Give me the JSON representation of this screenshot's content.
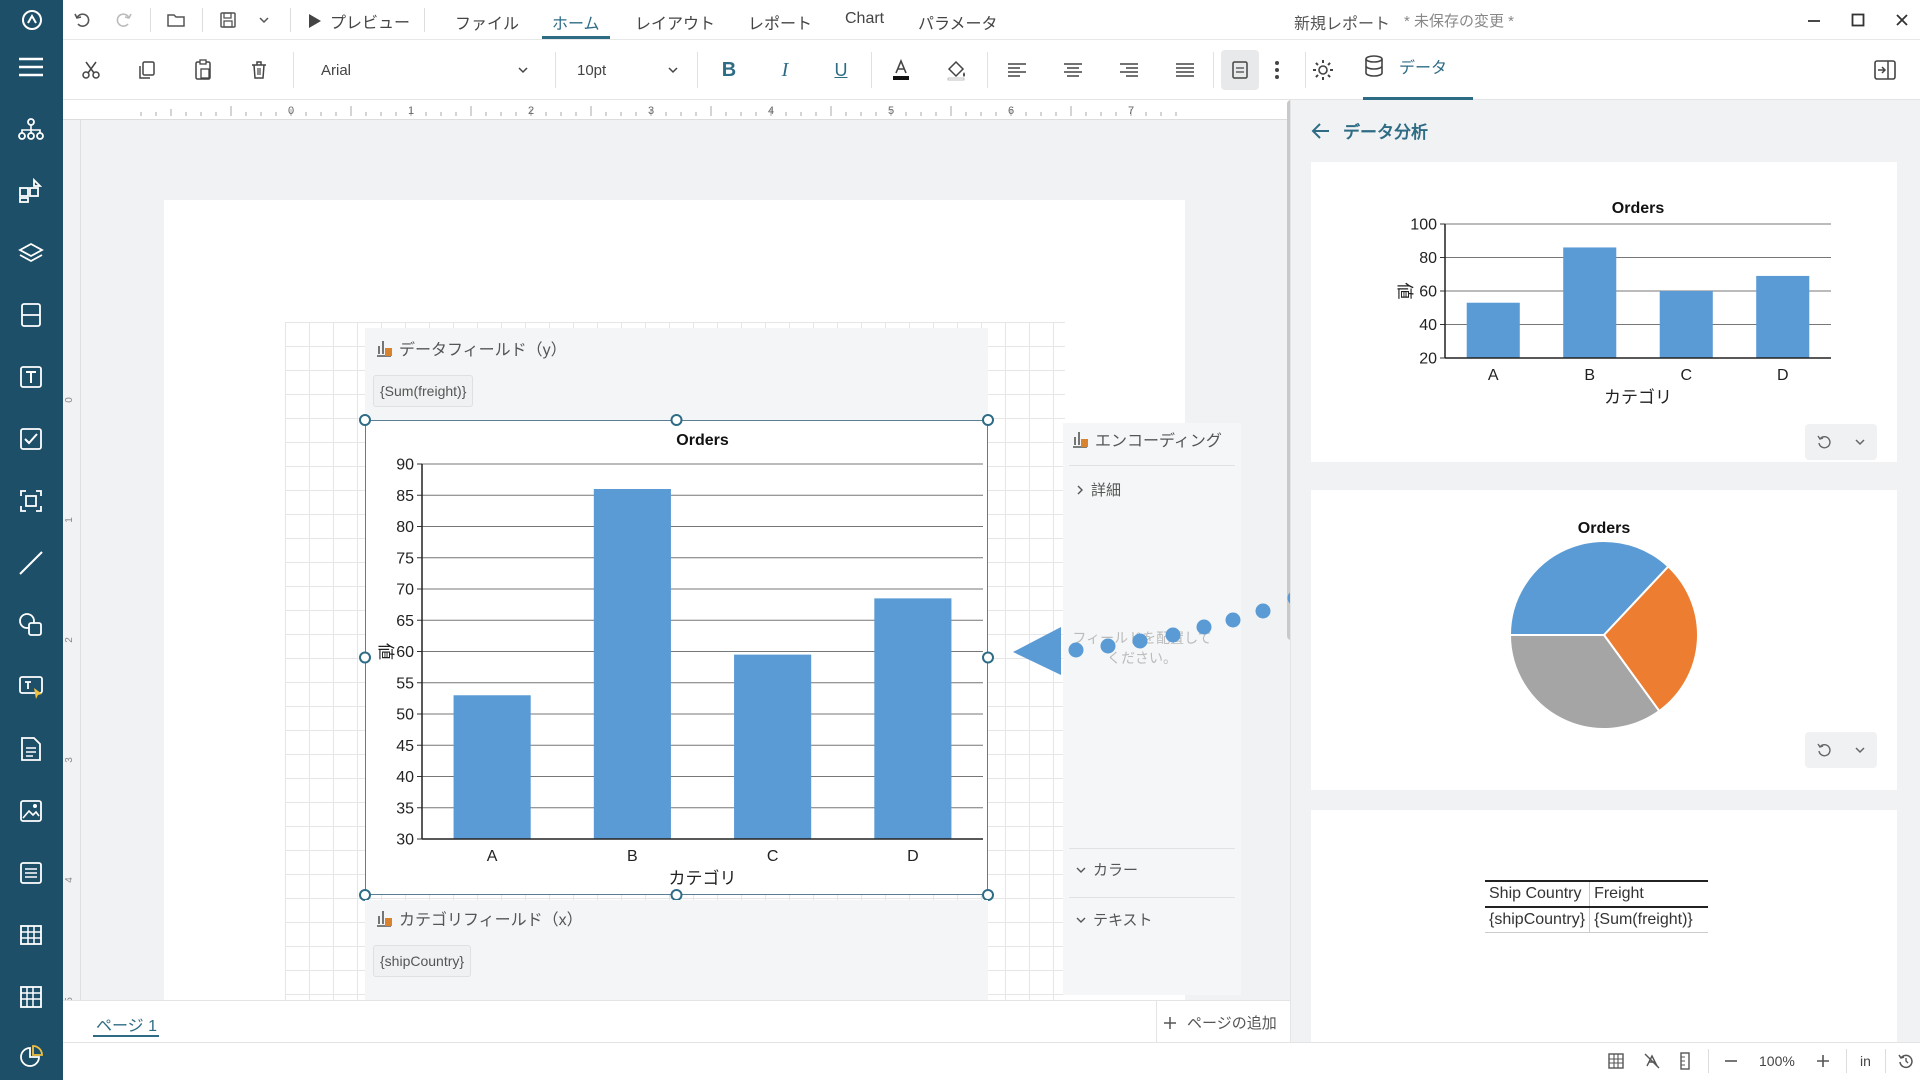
{
  "title": {
    "doc": "新規レポート",
    "status": "* 未保存の変更 *"
  },
  "menu": {
    "preview": "プレビュー",
    "tabs": [
      "ファイル",
      "ホーム",
      "レイアウト",
      "レポート",
      "Chart",
      "パラメータ"
    ],
    "active_tab": "ホーム"
  },
  "toolbar": {
    "font_family": "Arial",
    "font_size": "10pt",
    "data_tab": "データ"
  },
  "ruler": {
    "marks": [
      "0",
      "1",
      "2",
      "3",
      "4",
      "5",
      "6",
      "7"
    ],
    "vmarks": [
      "0",
      "1",
      "2",
      "3",
      "4",
      "5"
    ]
  },
  "canvas": {
    "y_field_label": "データフィールド（y）",
    "y_field_value": "{Sum(freight)}",
    "x_field_label": "カテゴリフィールド（x）",
    "x_field_value": "{shipCountry}",
    "encoding": "エンコーディング",
    "details": "詳細",
    "drop_hint": "フィールドを配置してください。",
    "color": "カラー",
    "text": "テキスト"
  },
  "page": {
    "tab": "ページ 1",
    "add": "ページの追加"
  },
  "status": {
    "zoom": "100%",
    "unit": "in"
  },
  "right": {
    "back_title": "データ分析",
    "table": {
      "headers": [
        "Ship Country",
        "Freight"
      ],
      "row": [
        "{shipCountry}",
        "{Sum(freight)}"
      ]
    }
  },
  "colors": {
    "bar": "#5b9bd5",
    "accent": "#2e6c86",
    "sidebar": "#1e4f68",
    "pie": [
      "#5b9bd5",
      "#ed7d31",
      "#a5a5a5"
    ]
  },
  "chart_data": [
    {
      "type": "bar",
      "title": "Orders",
      "categories": [
        "A",
        "B",
        "C",
        "D"
      ],
      "values": [
        53,
        86,
        59.5,
        68.5
      ],
      "xlabel": "カテゴリ",
      "ylabel": "値",
      "ylim": [
        30,
        90
      ],
      "yticks": [
        30,
        35,
        40,
        45,
        50,
        55,
        60,
        65,
        70,
        75,
        80,
        85,
        90
      ],
      "grid": true
    },
    {
      "type": "bar",
      "title": "Orders",
      "categories": [
        "A",
        "B",
        "C",
        "D"
      ],
      "values": [
        53,
        86,
        60,
        69
      ],
      "xlabel": "カテゴリ",
      "ylabel": "値",
      "ylim": [
        20,
        100
      ],
      "yticks": [
        20,
        40,
        60,
        80,
        100
      ],
      "grid": true
    },
    {
      "type": "pie",
      "title": "Orders",
      "values": [
        37,
        28,
        35
      ]
    }
  ]
}
